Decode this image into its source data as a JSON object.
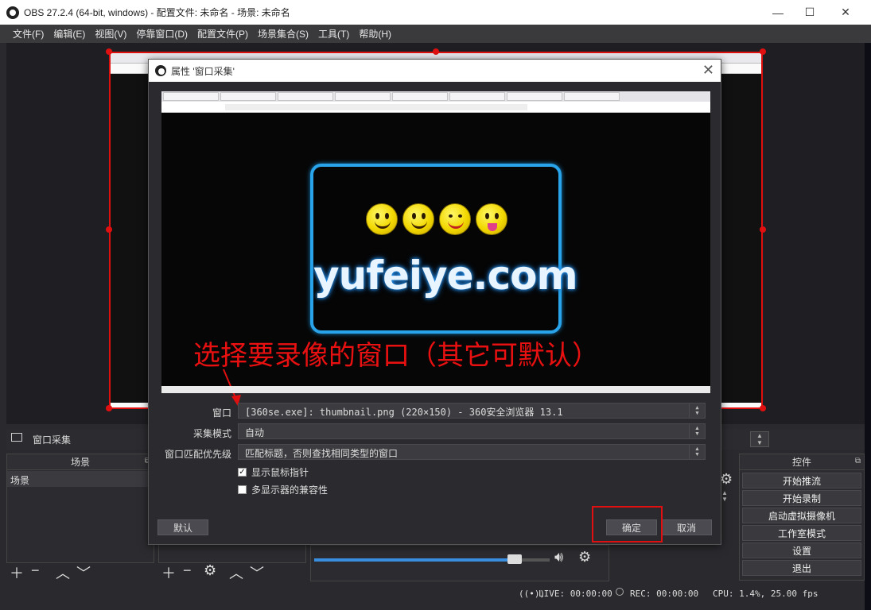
{
  "window": {
    "title": "OBS 27.2.4 (64-bit, windows) - 配置文件: 未命名 - 场景: 未命名",
    "minimize": "—",
    "maximize": "☐",
    "close": "✕"
  },
  "menu": [
    "文件(F)",
    "编辑(E)",
    "视图(V)",
    "停靠窗口(D)",
    "配置文件(P)",
    "场景集合(S)",
    "工具(T)",
    "帮助(H)"
  ],
  "source_bar": {
    "label": "窗口采集"
  },
  "dialog": {
    "title": "属性 '窗口采集'",
    "preview_logo_text": "yufeiye.com",
    "annotation": "选择要录像的窗口（其它可默认）",
    "fields": {
      "window_label": "窗口",
      "window_value": "[360se.exe]: thumbnail.png (220×150) - 360安全浏览器 13.1",
      "mode_label": "采集模式",
      "mode_value": "自动",
      "priority_label": "窗口匹配优先级",
      "priority_value": "匹配标题，否则查找相同类型的窗口"
    },
    "checkboxes": {
      "cursor_label": "显示鼠标指针",
      "cursor_checked": true,
      "multi_label": "多显示器的兼容性",
      "multi_checked": false
    },
    "buttons": {
      "default": "默认",
      "ok": "确定",
      "cancel": "取消"
    }
  },
  "docks": {
    "scenes": {
      "title": "场景",
      "items": [
        "场景"
      ]
    },
    "controls": {
      "title": "控件",
      "buttons": [
        "开始推流",
        "开始录制",
        "启动虚拟摄像机",
        "工作室模式",
        "设置",
        "退出"
      ]
    }
  },
  "status": {
    "live": "LIVE: 00:00:00",
    "rec": "REC: 00:00:00",
    "cpu": "CPU: 1.4%, 25.00 fps"
  },
  "colors": {
    "accent_red": "#e01010",
    "volume_blue": "#3a8ee0",
    "logo_blue": "#29a4ea"
  },
  "volume": {
    "level": 0.85
  }
}
